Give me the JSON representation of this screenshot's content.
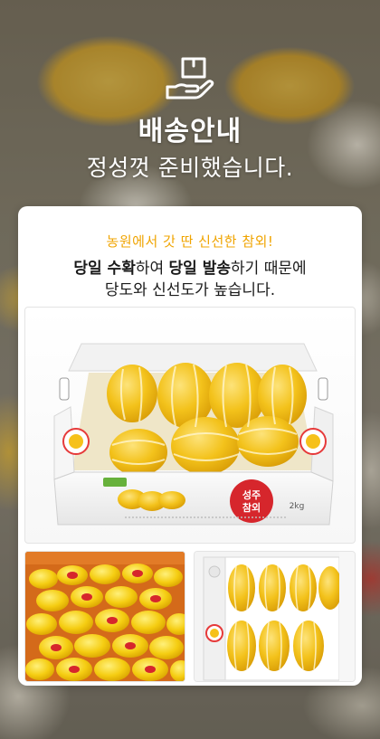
{
  "header": {
    "icon": "hand-with-box-icon",
    "title": "배송안내",
    "subtitle": "정성껏 준비했습니다."
  },
  "card": {
    "tagline": "농원에서 갓 딴 신선한 참외!",
    "line1": {
      "b1": "당일 수확",
      "t1": "하여 ",
      "b2": "당일 발송",
      "t2": "하기 때문에"
    },
    "line2": "당도와 신선도가 높습니다.",
    "box_label": {
      "brand": "성주참외",
      "weight": "2kg"
    }
  },
  "colors": {
    "accent": "#f0a400",
    "melon": "#f2c21a",
    "brand_red": "#d6262c"
  }
}
